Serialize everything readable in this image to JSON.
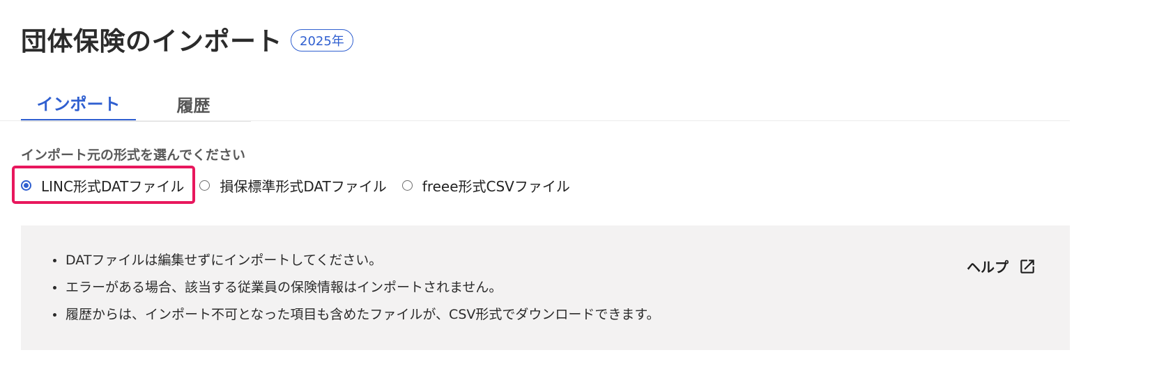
{
  "header": {
    "title": "団体保険のインポート",
    "year_badge": "2025年"
  },
  "tabs": [
    {
      "label": "インポート",
      "active": true
    },
    {
      "label": "履歴",
      "active": false
    }
  ],
  "format_select": {
    "label": "インポート元の形式を選んでください",
    "options": [
      {
        "label": "LINC形式DATファイル",
        "selected": true
      },
      {
        "label": "損保標準形式DATファイル",
        "selected": false
      },
      {
        "label": "freee形式CSVファイル",
        "selected": false
      }
    ]
  },
  "info": {
    "notes": [
      "DATファイルは編集せずにインポートしてください。",
      "エラーがある場合、該当する従業員の保険情報はインポートされません。",
      "履歴からは、インポート不可となった項目も含めたファイルが、CSV形式でダウンロードできます。"
    ],
    "help_label": "ヘルプ",
    "help_icon": "external-link-icon"
  },
  "colors": {
    "accent": "#2f5fd0",
    "highlight": "#e8175d",
    "info_background": "#f3f2f2"
  }
}
